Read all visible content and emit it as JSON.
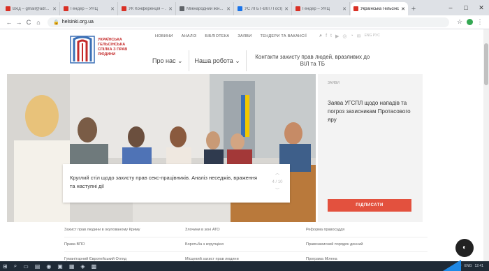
{
  "browser": {
    "tabs": [
      {
        "label": "Вхід – gmail@adr...",
        "fav": "#d93025"
      },
      {
        "label": "Гендер – УНЦ",
        "fav": "#d93025"
      },
      {
        "label": "УК Конференція – ...",
        "fav": "#d93025"
      },
      {
        "label": "Міжнародний жін...",
        "fav": "#5f6368"
      },
      {
        "label": "УС ЛГБТ-ВІЛ / Гостр...",
        "fav": "#1a73e8"
      },
      {
        "label": "Гендер – УНЦ",
        "fav": "#d93025"
      },
      {
        "label": "Українська Гельсінська...",
        "fav": "#d93025"
      }
    ],
    "new_tab": "+",
    "window_controls": [
      "–",
      "□",
      "✕"
    ],
    "url": "helsinki.org.ua",
    "nav": [
      "←",
      "→",
      "C",
      "⌂"
    ]
  },
  "site": {
    "logo_text": "УКРАЇНСЬКА ГЕЛЬСІНСЬКА СПІЛКА З ПРАВ ЛЮДИНИ",
    "topnav": [
      "НОВИНИ",
      "АНАЛІЗ",
      "БІБЛІОТЕКА",
      "ЗАЯВИ",
      "ТЕНДЕРИ ТА ВАКАНСІЇ"
    ],
    "topnav_icons": [
      "search-icon",
      "facebook-icon",
      "twitter-icon",
      "youtube-icon",
      "instagram-icon",
      "rss-icon",
      "mail-icon"
    ],
    "lang": "ENG РУС",
    "mainnav": [
      {
        "label": "Про нас",
        "caret": "⌄"
      },
      {
        "label": "Наша робота",
        "caret": "⌄"
      },
      {
        "label": "Контакти захисту прав людей, вразливих до ВІЛ та ТБ"
      }
    ],
    "hero_caption": "Круглий стіл щодо захисту прав секс-працівників. Аналіз неседжів, враження та наступні дії",
    "slider_counter": "4 / 10",
    "side": {
      "tag": "ЗАЯВИ",
      "title": "Заява УГСПЛ щодо нападів та погроз захисникам Протасового яру",
      "button": "ПІДПИСАТИ"
    },
    "links": [
      [
        "Захист прав людини в окупованому Криму",
        "Злочини в зоні АТО",
        "Реформа правосуддя"
      ],
      [
        "Права ВПО",
        "Боротьба з корупцією",
        "Правозахисний порядок денний"
      ],
      [
        "Гуманітарний Європейський Огляд",
        "Місцевий захист прав людини",
        "Програма Мілена"
      ]
    ]
  },
  "taskbar": {
    "items": [
      "⊞",
      "⌕",
      "▭",
      "▤",
      "◉",
      "▣",
      "▦",
      "◈",
      "▩"
    ],
    "tray": [
      "^",
      "ENG",
      "12:41"
    ]
  },
  "colors": {
    "accent": "#e3513e",
    "logo_red": "#c42b2b",
    "logo_blue": "#3a6fb5"
  }
}
